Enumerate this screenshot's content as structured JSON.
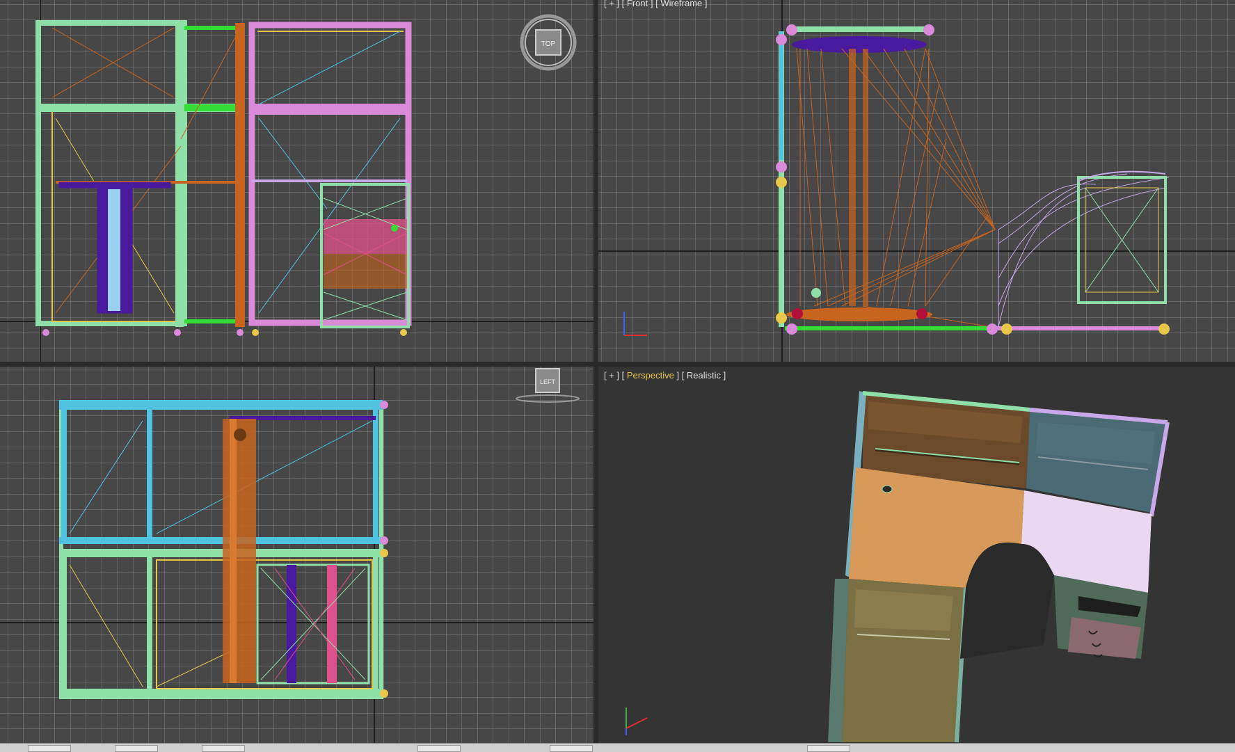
{
  "viewports": {
    "top": {
      "cube_label": "TOP"
    },
    "front": {
      "plus": "[ + ]",
      "view": "[ Front ]",
      "shading": "[ Wireframe ]"
    },
    "left": {
      "cube_label": "LEFT"
    },
    "perspective": {
      "plus": "[ + ]",
      "view_open": "[ ",
      "view": "Perspective",
      "view_close": " ]",
      "shading": "[ Realistic ]"
    }
  },
  "colors": {
    "grid_bg": "#474747",
    "grid_line": "#7a7a7a",
    "active_border": "#b0934a",
    "mint": "#8fe0a8",
    "cyan": "#4fc3e0",
    "orange": "#c8641e",
    "purple": "#4a1a9e",
    "pink": "#d98ad9",
    "magenta": "#e0508a",
    "yellow": "#e8c84a",
    "lavender": "#c8a8e8"
  },
  "icons": {
    "viewcube_top": "viewcube-icon",
    "viewcube_left": "viewcube-icon",
    "axis_front": "axis-tripod-icon",
    "axis_persp": "axis-tripod-icon"
  }
}
